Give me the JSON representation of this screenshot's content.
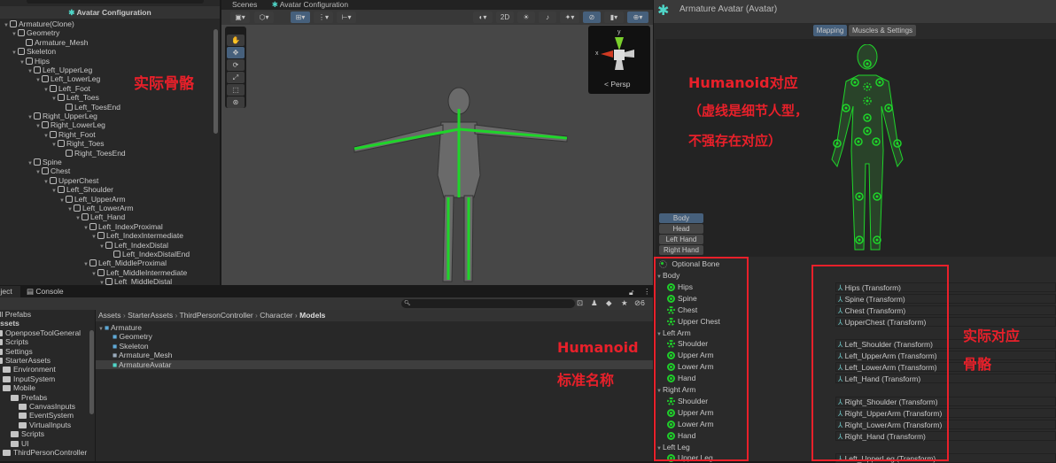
{
  "hierarchy": {
    "title": "Avatar Configuration",
    "items": [
      {
        "label": "Armature(Clone)",
        "depth": 0,
        "arrow": true
      },
      {
        "label": "Geometry",
        "depth": 1,
        "arrow": true
      },
      {
        "label": "Armature_Mesh",
        "depth": 2,
        "arrow": false
      },
      {
        "label": "Skeleton",
        "depth": 1,
        "arrow": true
      },
      {
        "label": "Hips",
        "depth": 2,
        "arrow": true
      },
      {
        "label": "Left_UpperLeg",
        "depth": 3,
        "arrow": true
      },
      {
        "label": "Left_LowerLeg",
        "depth": 4,
        "arrow": true
      },
      {
        "label": "Left_Foot",
        "depth": 5,
        "arrow": true
      },
      {
        "label": "Left_Toes",
        "depth": 6,
        "arrow": true
      },
      {
        "label": "Left_ToesEnd",
        "depth": 7,
        "arrow": false
      },
      {
        "label": "Right_UpperLeg",
        "depth": 3,
        "arrow": true
      },
      {
        "label": "Right_LowerLeg",
        "depth": 4,
        "arrow": true
      },
      {
        "label": "Right_Foot",
        "depth": 5,
        "arrow": true
      },
      {
        "label": "Right_Toes",
        "depth": 6,
        "arrow": true
      },
      {
        "label": "Right_ToesEnd",
        "depth": 7,
        "arrow": false
      },
      {
        "label": "Spine",
        "depth": 3,
        "arrow": true
      },
      {
        "label": "Chest",
        "depth": 4,
        "arrow": true
      },
      {
        "label": "UpperChest",
        "depth": 5,
        "arrow": true
      },
      {
        "label": "Left_Shoulder",
        "depth": 6,
        "arrow": true
      },
      {
        "label": "Left_UpperArm",
        "depth": 7,
        "arrow": true
      },
      {
        "label": "Left_LowerArm",
        "depth": 8,
        "arrow": true
      },
      {
        "label": "Left_Hand",
        "depth": 9,
        "arrow": true
      },
      {
        "label": "Left_IndexProximal",
        "depth": 10,
        "arrow": true
      },
      {
        "label": "Left_IndexIntermediate",
        "depth": 11,
        "arrow": true
      },
      {
        "label": "Left_IndexDistal",
        "depth": 12,
        "arrow": true
      },
      {
        "label": "Left_IndexDistalEnd",
        "depth": 13,
        "arrow": false
      },
      {
        "label": "Left_MiddleProximal",
        "depth": 10,
        "arrow": true
      },
      {
        "label": "Left_MiddleIntermediate",
        "depth": 11,
        "arrow": true
      },
      {
        "label": "Left_MiddleDistal",
        "depth": 12,
        "arrow": true
      }
    ]
  },
  "scene": {
    "tab1": "Scenes",
    "tab2": "Avatar Configuration",
    "btn_2d": "2D",
    "gizmo_y": "y",
    "gizmo_x": "x",
    "persp": "< Persp"
  },
  "project": {
    "tab_project": "Project",
    "tab_console": "Console",
    "hidden_count": "6",
    "tree": [
      {
        "label": "All Prefabs",
        "depth": 0
      },
      {
        "label": "Assets",
        "depth": 0,
        "bold": true
      },
      {
        "label": "OpenposeToolGeneral",
        "depth": 0
      },
      {
        "label": "Scripts",
        "depth": 0
      },
      {
        "label": "Settings",
        "depth": 0
      },
      {
        "label": "StarterAssets",
        "depth": 0
      },
      {
        "label": "Environment",
        "depth": 1
      },
      {
        "label": "InputSystem",
        "depth": 1
      },
      {
        "label": "Mobile",
        "depth": 1
      },
      {
        "label": "Prefabs",
        "depth": 2
      },
      {
        "label": "CanvasInputs",
        "depth": 3
      },
      {
        "label": "EventSystem",
        "depth": 3
      },
      {
        "label": "VirtualInputs",
        "depth": 3
      },
      {
        "label": "Scripts",
        "depth": 2
      },
      {
        "label": "UI",
        "depth": 2
      },
      {
        "label": "ThirdPersonController",
        "depth": 1
      }
    ],
    "breadcrumb": [
      "Assets",
      "StarterAssets",
      "ThirdPersonController",
      "Character",
      "Models"
    ],
    "files": [
      {
        "label": "Armature",
        "depth": 0
      },
      {
        "label": "Geometry",
        "depth": 1
      },
      {
        "label": "Skeleton",
        "depth": 1
      },
      {
        "label": "Armature_Mesh",
        "depth": 1
      },
      {
        "label": "ArmatureAvatar",
        "depth": 1,
        "selected": true
      }
    ]
  },
  "inspector": {
    "title": "Armature Avatar (Avatar)",
    "tab_mapping": "Mapping",
    "tab_muscles": "Muscles & Settings",
    "body_tabs": [
      "Body",
      "Head",
      "Left Hand",
      "Right Hand"
    ],
    "optional_bone": "Optional Bone",
    "bones": [
      {
        "label": "Body",
        "group": true
      },
      {
        "label": "Hips",
        "dashed": false,
        "transform": "Hips (Transform)"
      },
      {
        "label": "Spine",
        "dashed": false,
        "transform": "Spine (Transform)"
      },
      {
        "label": "Chest",
        "dashed": true,
        "transform": "Chest (Transform)"
      },
      {
        "label": "Upper Chest",
        "dashed": true,
        "transform": "UpperChest (Transform)"
      },
      {
        "label": "Left Arm",
        "group": true
      },
      {
        "label": "Shoulder",
        "dashed": true,
        "transform": "Left_Shoulder (Transform)"
      },
      {
        "label": "Upper Arm",
        "dashed": false,
        "transform": "Left_UpperArm (Transform)"
      },
      {
        "label": "Lower Arm",
        "dashed": false,
        "transform": "Left_LowerArm (Transform)"
      },
      {
        "label": "Hand",
        "dashed": false,
        "transform": "Left_Hand (Transform)"
      },
      {
        "label": "Right Arm",
        "group": true
      },
      {
        "label": "Shoulder",
        "dashed": true,
        "transform": "Right_Shoulder (Transform)"
      },
      {
        "label": "Upper Arm",
        "dashed": false,
        "transform": "Right_UpperArm (Transform)"
      },
      {
        "label": "Lower Arm",
        "dashed": false,
        "transform": "Right_LowerArm (Transform)"
      },
      {
        "label": "Hand",
        "dashed": false,
        "transform": "Right_Hand (Transform)"
      },
      {
        "label": "Left Leg",
        "group": true
      },
      {
        "label": "Upper Leg",
        "dashed": false,
        "transform": "Left_UpperLeg (Transform)"
      }
    ]
  },
  "annotations": {
    "actual_bones": "实际骨骼",
    "humanoid_map": "Humanoid对应",
    "dashed_note1": "（虚线是细节人型，",
    "dashed_note2": "不强存在对应）",
    "std_name1": "Humanoid",
    "std_name2": "标准名称",
    "actual_map1": "实际对应",
    "actual_map2": "骨骼"
  },
  "colors": {
    "accent": "#46607c",
    "bone_green": "#1fcf2a",
    "annotation_red": "#e8202a"
  }
}
